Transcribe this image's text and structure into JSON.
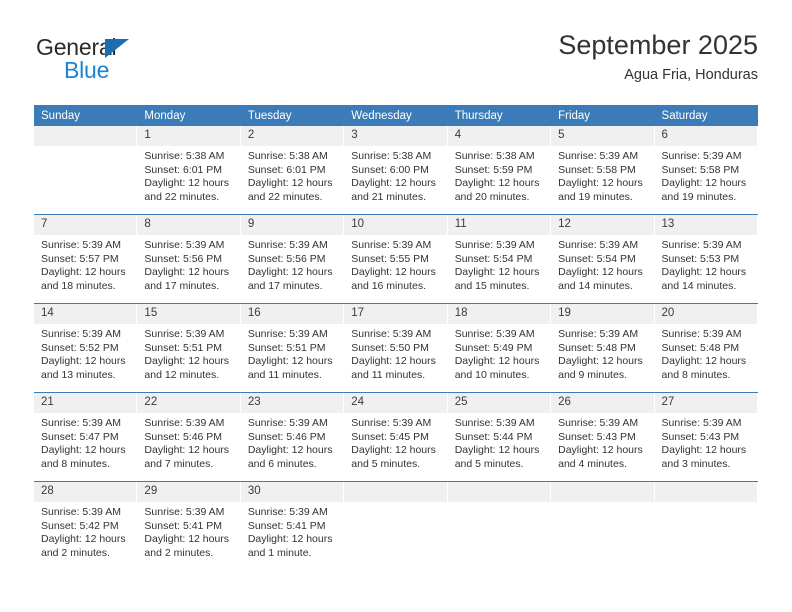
{
  "logo": {
    "word_top": "General",
    "word_bottom": "Blue",
    "triangle_color": "#1c6cb5",
    "blue_text_color": "#1b83d3"
  },
  "header": {
    "title": "September 2025",
    "subtitle": "Agua Fria, Honduras"
  },
  "colors": {
    "header_blue": "#3b7cb8",
    "daynum_band": "#f0f0f0",
    "text": "#333333"
  },
  "weekday_headers": [
    "Sunday",
    "Monday",
    "Tuesday",
    "Wednesday",
    "Thursday",
    "Friday",
    "Saturday"
  ],
  "labels": {
    "sunrise_prefix": "Sunrise:",
    "sunset_prefix": "Sunset:",
    "daylight_prefix": "Daylight:"
  },
  "weeks": [
    [
      {
        "day": "",
        "blank": true,
        "l1": "",
        "l2": "",
        "l3": "",
        "l4": ""
      },
      {
        "day": "1",
        "l1": "Sunrise: 5:38 AM",
        "l2": "Sunset: 6:01 PM",
        "l3": "Daylight: 12 hours",
        "l4": "and 22 minutes."
      },
      {
        "day": "2",
        "l1": "Sunrise: 5:38 AM",
        "l2": "Sunset: 6:01 PM",
        "l3": "Daylight: 12 hours",
        "l4": "and 22 minutes."
      },
      {
        "day": "3",
        "l1": "Sunrise: 5:38 AM",
        "l2": "Sunset: 6:00 PM",
        "l3": "Daylight: 12 hours",
        "l4": "and 21 minutes."
      },
      {
        "day": "4",
        "l1": "Sunrise: 5:38 AM",
        "l2": "Sunset: 5:59 PM",
        "l3": "Daylight: 12 hours",
        "l4": "and 20 minutes."
      },
      {
        "day": "5",
        "l1": "Sunrise: 5:39 AM",
        "l2": "Sunset: 5:58 PM",
        "l3": "Daylight: 12 hours",
        "l4": "and 19 minutes."
      },
      {
        "day": "6",
        "l1": "Sunrise: 5:39 AM",
        "l2": "Sunset: 5:58 PM",
        "l3": "Daylight: 12 hours",
        "l4": "and 19 minutes."
      }
    ],
    [
      {
        "day": "7",
        "l1": "Sunrise: 5:39 AM",
        "l2": "Sunset: 5:57 PM",
        "l3": "Daylight: 12 hours",
        "l4": "and 18 minutes."
      },
      {
        "day": "8",
        "l1": "Sunrise: 5:39 AM",
        "l2": "Sunset: 5:56 PM",
        "l3": "Daylight: 12 hours",
        "l4": "and 17 minutes."
      },
      {
        "day": "9",
        "l1": "Sunrise: 5:39 AM",
        "l2": "Sunset: 5:56 PM",
        "l3": "Daylight: 12 hours",
        "l4": "and 17 minutes."
      },
      {
        "day": "10",
        "l1": "Sunrise: 5:39 AM",
        "l2": "Sunset: 5:55 PM",
        "l3": "Daylight: 12 hours",
        "l4": "and 16 minutes."
      },
      {
        "day": "11",
        "l1": "Sunrise: 5:39 AM",
        "l2": "Sunset: 5:54 PM",
        "l3": "Daylight: 12 hours",
        "l4": "and 15 minutes."
      },
      {
        "day": "12",
        "l1": "Sunrise: 5:39 AM",
        "l2": "Sunset: 5:54 PM",
        "l3": "Daylight: 12 hours",
        "l4": "and 14 minutes."
      },
      {
        "day": "13",
        "l1": "Sunrise: 5:39 AM",
        "l2": "Sunset: 5:53 PM",
        "l3": "Daylight: 12 hours",
        "l4": "and 14 minutes."
      }
    ],
    [
      {
        "day": "14",
        "l1": "Sunrise: 5:39 AM",
        "l2": "Sunset: 5:52 PM",
        "l3": "Daylight: 12 hours",
        "l4": "and 13 minutes."
      },
      {
        "day": "15",
        "l1": "Sunrise: 5:39 AM",
        "l2": "Sunset: 5:51 PM",
        "l3": "Daylight: 12 hours",
        "l4": "and 12 minutes."
      },
      {
        "day": "16",
        "l1": "Sunrise: 5:39 AM",
        "l2": "Sunset: 5:51 PM",
        "l3": "Daylight: 12 hours",
        "l4": "and 11 minutes."
      },
      {
        "day": "17",
        "l1": "Sunrise: 5:39 AM",
        "l2": "Sunset: 5:50 PM",
        "l3": "Daylight: 12 hours",
        "l4": "and 11 minutes."
      },
      {
        "day": "18",
        "l1": "Sunrise: 5:39 AM",
        "l2": "Sunset: 5:49 PM",
        "l3": "Daylight: 12 hours",
        "l4": "and 10 minutes."
      },
      {
        "day": "19",
        "l1": "Sunrise: 5:39 AM",
        "l2": "Sunset: 5:48 PM",
        "l3": "Daylight: 12 hours",
        "l4": "and 9 minutes."
      },
      {
        "day": "20",
        "l1": "Sunrise: 5:39 AM",
        "l2": "Sunset: 5:48 PM",
        "l3": "Daylight: 12 hours",
        "l4": "and 8 minutes."
      }
    ],
    [
      {
        "day": "21",
        "l1": "Sunrise: 5:39 AM",
        "l2": "Sunset: 5:47 PM",
        "l3": "Daylight: 12 hours",
        "l4": "and 8 minutes."
      },
      {
        "day": "22",
        "l1": "Sunrise: 5:39 AM",
        "l2": "Sunset: 5:46 PM",
        "l3": "Daylight: 12 hours",
        "l4": "and 7 minutes."
      },
      {
        "day": "23",
        "l1": "Sunrise: 5:39 AM",
        "l2": "Sunset: 5:46 PM",
        "l3": "Daylight: 12 hours",
        "l4": "and 6 minutes."
      },
      {
        "day": "24",
        "l1": "Sunrise: 5:39 AM",
        "l2": "Sunset: 5:45 PM",
        "l3": "Daylight: 12 hours",
        "l4": "and 5 minutes."
      },
      {
        "day": "25",
        "l1": "Sunrise: 5:39 AM",
        "l2": "Sunset: 5:44 PM",
        "l3": "Daylight: 12 hours",
        "l4": "and 5 minutes."
      },
      {
        "day": "26",
        "l1": "Sunrise: 5:39 AM",
        "l2": "Sunset: 5:43 PM",
        "l3": "Daylight: 12 hours",
        "l4": "and 4 minutes."
      },
      {
        "day": "27",
        "l1": "Sunrise: 5:39 AM",
        "l2": "Sunset: 5:43 PM",
        "l3": "Daylight: 12 hours",
        "l4": "and 3 minutes."
      }
    ],
    [
      {
        "day": "28",
        "l1": "Sunrise: 5:39 AM",
        "l2": "Sunset: 5:42 PM",
        "l3": "Daylight: 12 hours",
        "l4": "and 2 minutes."
      },
      {
        "day": "29",
        "l1": "Sunrise: 5:39 AM",
        "l2": "Sunset: 5:41 PM",
        "l3": "Daylight: 12 hours",
        "l4": "and 2 minutes."
      },
      {
        "day": "30",
        "l1": "Sunrise: 5:39 AM",
        "l2": "Sunset: 5:41 PM",
        "l3": "Daylight: 12 hours",
        "l4": "and 1 minute."
      },
      {
        "day": "",
        "blank": true,
        "l1": "",
        "l2": "",
        "l3": "",
        "l4": ""
      },
      {
        "day": "",
        "blank": true,
        "l1": "",
        "l2": "",
        "l3": "",
        "l4": ""
      },
      {
        "day": "",
        "blank": true,
        "l1": "",
        "l2": "",
        "l3": "",
        "l4": ""
      },
      {
        "day": "",
        "blank": true,
        "l1": "",
        "l2": "",
        "l3": "",
        "l4": ""
      }
    ]
  ]
}
